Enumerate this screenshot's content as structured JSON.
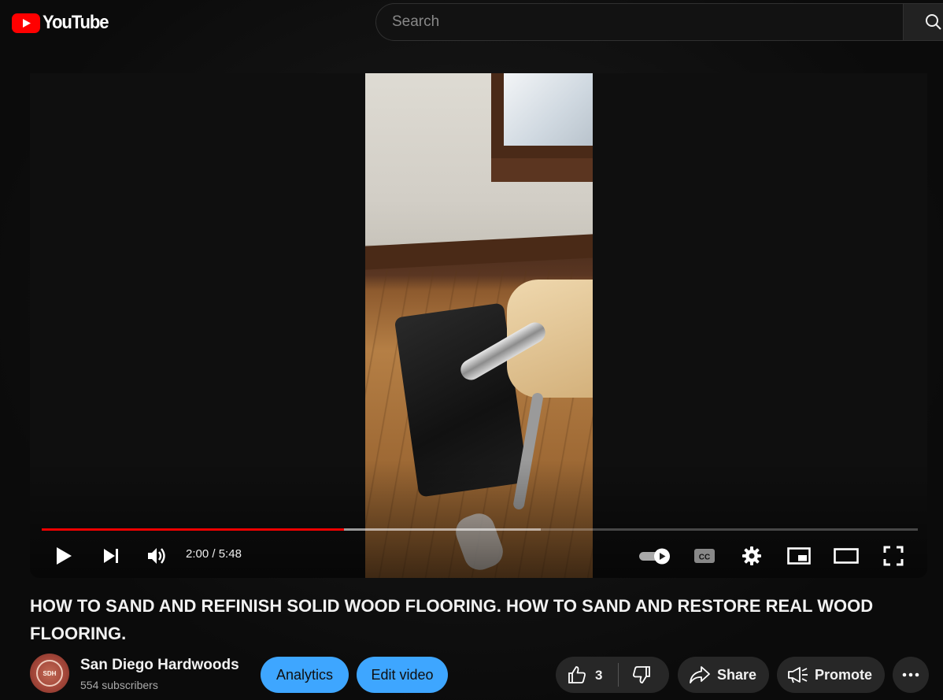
{
  "masthead": {
    "logo_text": "YouTube",
    "search_placeholder": "Search"
  },
  "player": {
    "time_current": "2:00",
    "time_total": "5:48",
    "time_separator": " / ",
    "progress_played": 0.345,
    "progress_loaded": 0.57,
    "autoplay_on": true
  },
  "video": {
    "title": "HOW TO SAND AND REFINISH SOLID WOOD FLOORING. HOW TO SAND AND RESTORE REAL WOOD FLOORING."
  },
  "channel": {
    "name": "San Diego Hardwoods",
    "subscribers": "554 subscribers",
    "avatar_text": "SDH"
  },
  "actions": {
    "analytics_label": "Analytics",
    "edit_label": "Edit video",
    "like_count": "3",
    "share_label": "Share",
    "promote_label": "Promote"
  },
  "colors": {
    "brand_red": "#ff0000",
    "progress_red": "#ee0000",
    "accent_blue": "#3ea6ff",
    "pill_grey": "#272727"
  },
  "icons": {
    "search": "search-icon",
    "play": "play-icon",
    "next": "next-icon",
    "volume": "volume-icon",
    "autoplay": "autoplay-toggle-icon",
    "captions": "closed-captions-icon",
    "settings": "gear-icon",
    "miniplayer": "miniplayer-icon",
    "theater": "theater-mode-icon",
    "fullscreen": "fullscreen-icon",
    "like": "thumbs-up-icon",
    "dislike": "thumbs-down-icon",
    "share": "share-arrow-icon",
    "promote": "megaphone-icon",
    "more": "more-horizontal-icon"
  }
}
